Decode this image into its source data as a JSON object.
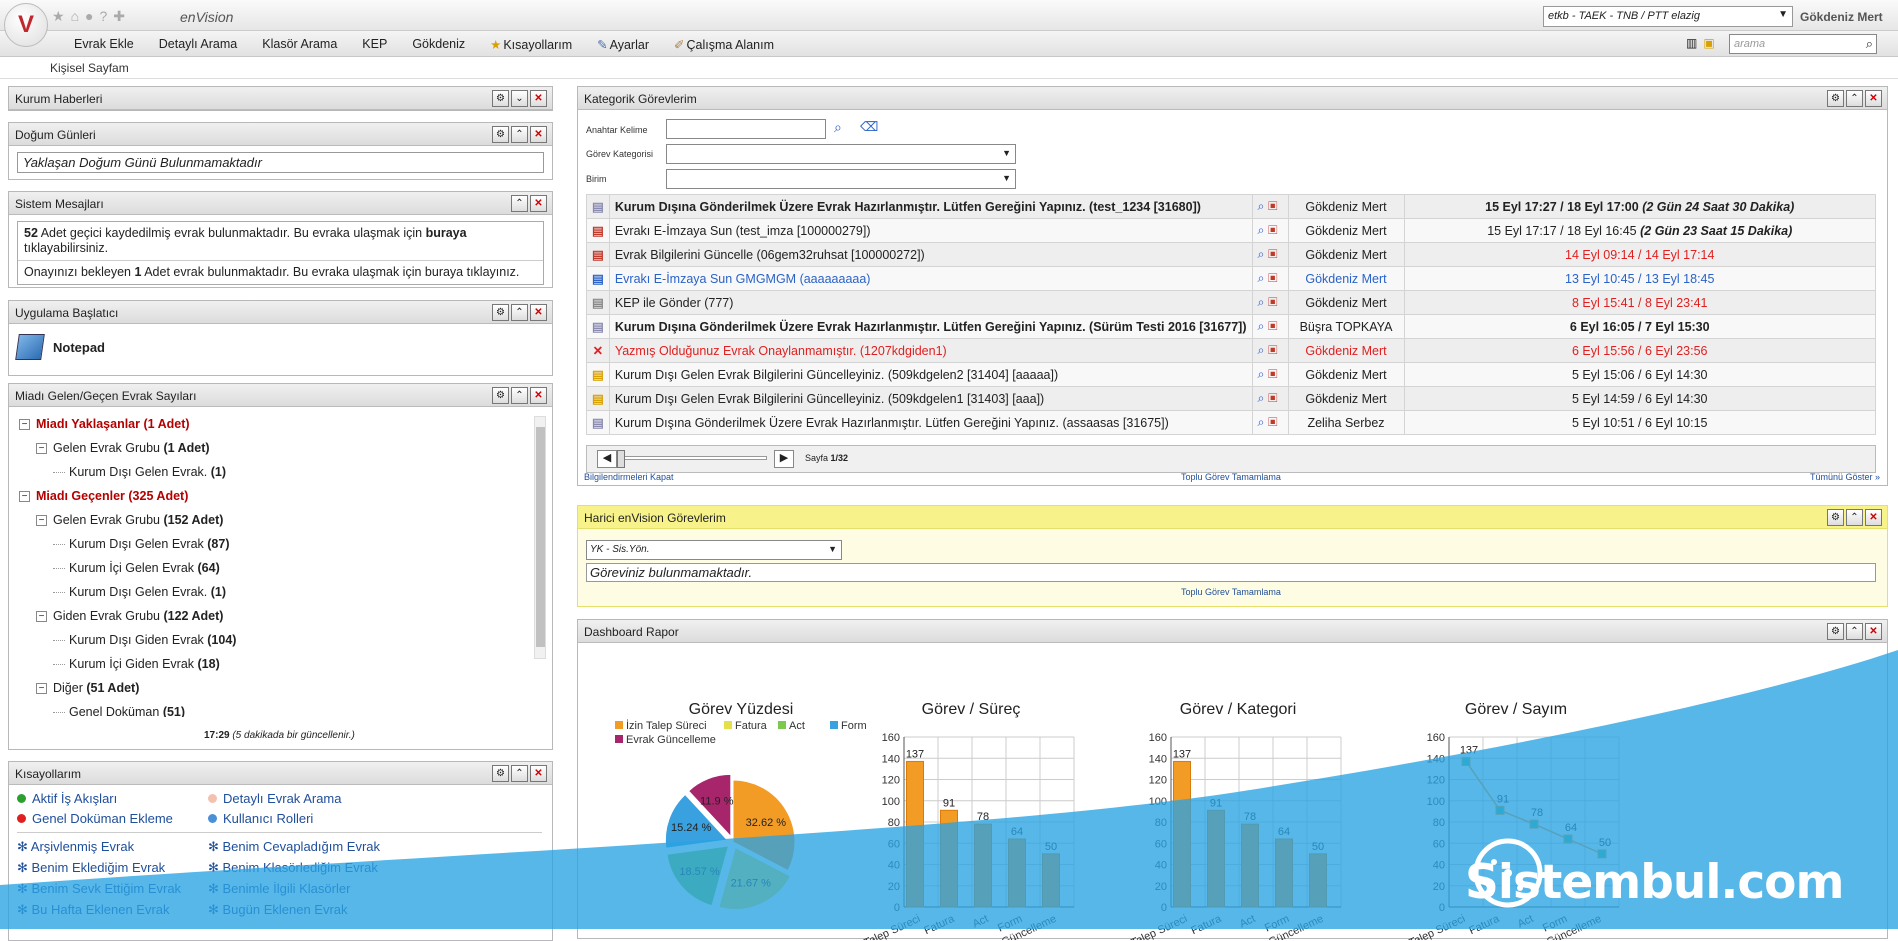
{
  "app": {
    "brand": "enVision",
    "unit_selector": "etkb - TAEK - TNB / PTT elazig",
    "user_name": "Gökdeniz Mert",
    "search_placeholder": "arama",
    "page_tab": "Kişisel Sayfam"
  },
  "menu": [
    "Evrak Ekle",
    "Detaylı Arama",
    "Klasör Arama",
    "KEP",
    "Gökdeniz",
    "Kısayollarım",
    "Ayarlar",
    "Çalışma Alanım"
  ],
  "panels": {
    "haberler": {
      "title": "Kurum Haberleri"
    },
    "dogum": {
      "title": "Doğum Günleri",
      "text": "Yaklaşan Doğum Günü Bulunmamaktadır"
    },
    "sistem": {
      "title": "Sistem Mesajları",
      "msg1_count": "52",
      "msg1_text": " Adet geçici kaydedilmiş evrak bulunmaktadır. Bu evraka ulaşmak için ",
      "msg1_link": "buraya",
      "msg1_tail": "tıklayabilirsiniz.",
      "msg2_pre": "Onayınızı bekleyen ",
      "msg2_count": "1",
      "msg2_text": " Adet evrak bulunmaktadır. Bu evraka ulaşmak için buraya tıklayınız."
    },
    "baslatici": {
      "title": "Uygulama Başlatıcı",
      "app": "Notepad"
    },
    "miadi": {
      "title": "Miadı Gelen/Geçen Evrak Sayıları",
      "tree": [
        {
          "level": 0,
          "style": "red",
          "label": "Miadı Yaklaşanlar (1 Adet)"
        },
        {
          "level": 1,
          "label": "Gelen Evrak Grubu ",
          "count": "(1 Adet)"
        },
        {
          "level": 2,
          "label": "Kurum Dışı Gelen Evrak. ",
          "count": "(1)"
        },
        {
          "level": 0,
          "style": "red",
          "label": "Miadı Geçenler (325 Adet)"
        },
        {
          "level": 1,
          "label": "Gelen Evrak Grubu ",
          "count": "(152 Adet)"
        },
        {
          "level": 2,
          "label": "Kurum Dışı Gelen Evrak ",
          "count": "(87)"
        },
        {
          "level": 2,
          "label": "Kurum İçi Gelen Evrak ",
          "count": "(64)"
        },
        {
          "level": 2,
          "label": "Kurum Dışı Gelen Evrak. ",
          "count": "(1)"
        },
        {
          "level": 1,
          "label": "Giden Evrak Grubu ",
          "count": "(122 Adet)"
        },
        {
          "level": 2,
          "label": "Kurum Dışı Giden Evrak ",
          "count": "(104)"
        },
        {
          "level": 2,
          "label": "Kurum İçi Giden Evrak ",
          "count": "(18)"
        },
        {
          "level": 1,
          "label": "Diğer ",
          "count": "(51 Adet)"
        },
        {
          "level": 2,
          "label": "Genel Doküman ",
          "count": "(51)"
        }
      ],
      "updated_time": "17:29",
      "updated_note": " (5 dakikada bir güncellenir.)"
    },
    "kisayollar": {
      "title": "Kısayollarım",
      "items": [
        {
          "label": "Aktif İş Akışları",
          "color": "#2ca02c"
        },
        {
          "label": "Detaylı Evrak Arama",
          "color": "#f4c0b0"
        },
        {
          "label": "Genel Doküman Ekleme",
          "color": "#e02020"
        },
        {
          "label": "Kullanıcı Rolleri",
          "color": "#4a90d9"
        },
        {
          "label": "Arşivlenmiş Evrak"
        },
        {
          "label": "Benim Cevapladığım Evrak"
        },
        {
          "label": "Benim Eklediğim Evrak"
        },
        {
          "label": "Benim Klasörlediğim Evrak"
        },
        {
          "label": "Benim Sevk Ettiğim Evrak"
        },
        {
          "label": "Benimle İlgili Klasörler"
        },
        {
          "label": "Bu Hafta Eklenen Evrak"
        },
        {
          "label": "Bugün Eklenen Evrak"
        }
      ]
    },
    "kategorik": {
      "title": "Kategorik Görevlerim",
      "f_keyword": "Anahtar Kelime",
      "f_category": "Görev Kategorisi",
      "f_unit": "Birim",
      "rows": [
        {
          "subject": "Kurum Dışına Gönderilmek Üzere Evrak Hazırlanmıştır. Lütfen Gereğini Yapınız. (test_1234 [31680])",
          "person": "Gökdeniz Mert",
          "date": "15 Eyl 17:27 / 18 Eyl 17:00",
          "remain": " (2 Gün 24 Saat 30 Dakika)",
          "style": "bold"
        },
        {
          "subject": "Evrakı E-İmzaya Sun (test_imza [100000279])",
          "person": "Gökdeniz Mert",
          "date": "15 Eyl 17:17 / 18 Eyl 16:45",
          "remain": " (2 Gün 23 Saat 15 Dakika)",
          "style": "normal"
        },
        {
          "subject": "Evrak Bilgilerini Güncelle (06gem32ruhsat [100000272])",
          "person": "Gökdeniz Mert",
          "date": "14 Eyl 09:14 / 14 Eyl 17:14",
          "remain": "",
          "style": "datered"
        },
        {
          "subject": "Evrakı E-İmzaya Sun GMGMGM (aaaaaaaaa)",
          "person": "Gökdeniz Mert",
          "date": "13 Eyl 10:45 / 13 Eyl 18:45",
          "remain": "",
          "style": "blue"
        },
        {
          "subject": "KEP ile Gönder (777)",
          "person": "Gökdeniz Mert",
          "date": "8 Eyl 15:41 / 8 Eyl 23:41",
          "remain": "",
          "style": "datered"
        },
        {
          "subject": "Kurum Dışına Gönderilmek Üzere Evrak Hazırlanmıştır. Lütfen Gereğini Yapınız. (Sürüm Testi 2016 [31677])",
          "person": "Büşra TOPKAYA",
          "date": "6 Eyl 16:05 / 7 Eyl 15:30",
          "remain": "",
          "style": "bold"
        },
        {
          "subject": "Yazmış Olduğunuz Evrak Onaylanmamıştır. (1207kdgiden1)",
          "person": "Gökdeniz Mert",
          "date": "6 Eyl 15:56 / 6 Eyl 23:56",
          "remain": "",
          "style": "red"
        },
        {
          "subject": "Kurum Dışı Gelen Evrak Bilgilerini Güncelleyiniz. (509kdgelen2 [31404] [aaaaa])",
          "person": "Gökdeniz Mert",
          "date": "5 Eyl 15:06 / 6 Eyl 14:30",
          "remain": "",
          "style": "normal"
        },
        {
          "subject": "Kurum Dışı Gelen Evrak Bilgilerini Güncelleyiniz. (509kdgelen1 [31403] [aaa])",
          "person": "Gökdeniz Mert",
          "date": "5 Eyl 14:59 / 6 Eyl 14:30",
          "remain": "",
          "style": "normal"
        },
        {
          "subject": "Kurum Dışına Gönderilmek Üzere Evrak Hazırlanmıştır. Lütfen Gereğini Yapınız. (assaasas [31675])",
          "person": "Zeliha Serbez",
          "date": "5 Eyl 10:51 / 6 Eyl 10:15",
          "remain": "",
          "style": "normal"
        }
      ],
      "page_label": "Sayfa ",
      "page_value": "1/32",
      "link_close": "Bilgilendirmeleri Kapat",
      "link_complete": "Toplu Görev Tamamlama",
      "link_all": "Tümünü Göster »"
    },
    "harici": {
      "title": "Harici enVision Görevlerim",
      "select": "YK - Sis.Yön.",
      "empty": "Göreviniz bulunmamaktadır.",
      "link_complete": "Toplu Görev Tamamlama"
    },
    "dashboard": {
      "title": "Dashboard Rapor"
    }
  },
  "chart_data": [
    {
      "type": "pie",
      "title": "Görev Yüzdesi",
      "labels": [
        "İzin Talep Süreci",
        "Fatura",
        "Act",
        "Form",
        "Evrak Güncelleme"
      ],
      "values": [
        32.62,
        21.67,
        18.57,
        15.24,
        11.9
      ],
      "value_labels": [
        "32.62 %",
        "21.67 %",
        "18.57 %",
        "15.24 %",
        "11.9 %"
      ],
      "colors": [
        "#f39c25",
        "#e3e04a",
        "#7ec850",
        "#3aa1e0",
        "#a6256b"
      ],
      "legend": "top"
    },
    {
      "type": "bar",
      "title": "Görev / Süreç",
      "categories": [
        "İzin Talep Süreci",
        "Fatura",
        "Act",
        "Form",
        "Evrak Güncelleme"
      ],
      "values": [
        137,
        91,
        78,
        64,
        50
      ],
      "ylim": [
        0,
        160
      ],
      "yticks": [
        0,
        20,
        40,
        60,
        80,
        100,
        120,
        140,
        160
      ],
      "grid": true,
      "color": "#f39c25"
    },
    {
      "type": "bar",
      "title": "Görev / Kategori",
      "categories": [
        "İzin Talep Süreci",
        "Fatura",
        "Act",
        "Form",
        "Evrak Güncelleme"
      ],
      "values": [
        137,
        91,
        78,
        64,
        50
      ],
      "ylim": [
        0,
        160
      ],
      "yticks": [
        0,
        20,
        40,
        60,
        80,
        100,
        120,
        140,
        160
      ],
      "grid": true,
      "color": "#f39c25"
    },
    {
      "type": "line",
      "title": "Görev / Sayım",
      "categories": [
        "İzin Talep Süreci",
        "Fatura",
        "Act",
        "Form",
        "Evrak Güncelleme"
      ],
      "values": [
        137,
        91,
        78,
        64,
        50
      ],
      "ylim": [
        0,
        160
      ],
      "yticks": [
        0,
        20,
        40,
        60,
        80,
        100,
        120,
        140,
        160
      ],
      "grid": true,
      "color": "#f39c25",
      "marker_color": "#3cc39a"
    }
  ],
  "watermark": {
    "text": "Sistembul.com"
  }
}
